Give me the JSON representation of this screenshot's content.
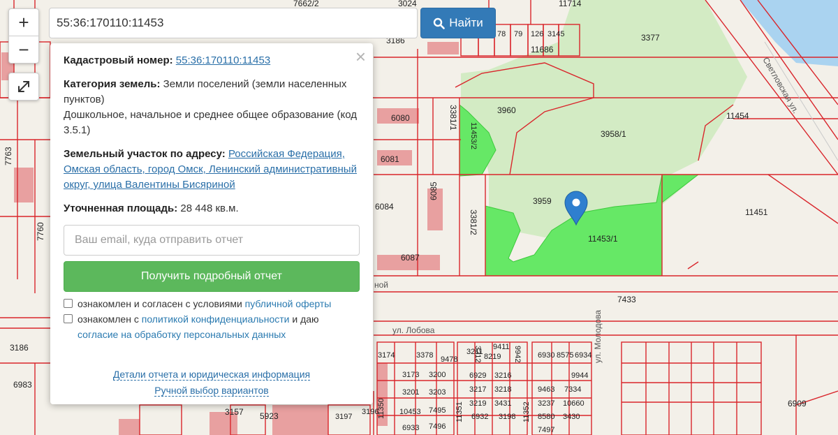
{
  "search": {
    "value": "55:36:170110:11453",
    "button_label": "Найти",
    "icon": "search-icon"
  },
  "zoom": {
    "in_label": "+",
    "out_label": "−",
    "fullscreen_icon": "expand-arrows-icon"
  },
  "popup": {
    "close_label": "×",
    "cadastral_label": "Кадастровый номер:",
    "cadastral_value": "55:36:170110:11453",
    "category_label": "Категория земель:",
    "category_value": "Земли поселений (земли населенных пунктов)",
    "usage_value": "Дошкольное, начальное и среднее общее образование (код 3.5.1)",
    "address_label": "Земельный участок по адресу:",
    "address_value": "Российская Федерация, Омская область, город Омск, Ленинский административный округ, улица Валентины Бисяриной",
    "area_label": "Уточненная площадь:",
    "area_value": "28 448 кв.м.",
    "email_placeholder": "Ваш email, куда отправить отчет",
    "report_button": "Получить подробный отчет",
    "agree1_text": "ознакомлен и согласен с условиями ",
    "agree1_link": "публичной оферты",
    "agree2_text1": "ознакомлен с ",
    "agree2_link1": "политикой конфиденциальности",
    "agree2_text2": " и даю ",
    "agree2_link2": "согласие на обработку персональных данных",
    "footer_link1": "Детали отчета и юридическая информация",
    "footer_link2": "Ручной выбор вариантов"
  },
  "map": {
    "colors": {
      "parcel_line": "#d9252b",
      "highlight": "#66e866",
      "park": "#d3ebc4",
      "building": "#e8a0a0",
      "water": "#aad3f0",
      "marker": "#2f7fcf"
    },
    "labels": [
      {
        "text": "3024"
      },
      {
        "text": "7662/2"
      },
      {
        "text": "3186"
      },
      {
        "text": "11714"
      },
      {
        "text": "78"
      },
      {
        "text": "79"
      },
      {
        "text": "126"
      },
      {
        "text": "3145"
      },
      {
        "text": "11686"
      },
      {
        "text": "3377"
      },
      {
        "text": "3960"
      },
      {
        "text": "3958/1"
      },
      {
        "text": "11454"
      },
      {
        "text": "6080"
      },
      {
        "text": "3381/1"
      },
      {
        "text": "11453/2"
      },
      {
        "text": "6081"
      },
      {
        "text": "6084"
      },
      {
        "text": "6085"
      },
      {
        "text": "3381/2"
      },
      {
        "text": "3959"
      },
      {
        "text": "11453/1"
      },
      {
        "text": "11451"
      },
      {
        "text": "6087"
      },
      {
        "text": "7433"
      },
      {
        "text": "ул. Лобова"
      },
      {
        "text": "Светловская ул."
      },
      {
        "text": "ул. Молодова"
      },
      {
        "text": "3174"
      },
      {
        "text": "3378"
      },
      {
        "text": "9478"
      },
      {
        "text": "3211"
      },
      {
        "text": "8219"
      },
      {
        "text": "9411"
      },
      {
        "text": "6930"
      },
      {
        "text": "8575"
      },
      {
        "text": "6934"
      },
      {
        "text": "3173"
      },
      {
        "text": "3200"
      },
      {
        "text": "6929"
      },
      {
        "text": "3216"
      },
      {
        "text": "9944"
      },
      {
        "text": "3201"
      },
      {
        "text": "3203"
      },
      {
        "text": "3217"
      },
      {
        "text": "3218"
      },
      {
        "text": "9463"
      },
      {
        "text": "7334"
      },
      {
        "text": "3219"
      },
      {
        "text": "3431"
      },
      {
        "text": "3237"
      },
      {
        "text": "10660"
      },
      {
        "text": "10453"
      },
      {
        "text": "7495"
      },
      {
        "text": "6932"
      },
      {
        "text": "8580"
      },
      {
        "text": "3198"
      },
      {
        "text": "3430"
      },
      {
        "text": "3197"
      },
      {
        "text": "3196"
      },
      {
        "text": "6933"
      },
      {
        "text": "7496"
      },
      {
        "text": "7497"
      },
      {
        "text": "3157"
      },
      {
        "text": "5923"
      },
      {
        "text": "3186"
      },
      {
        "text": "6983"
      },
      {
        "text": "7763"
      },
      {
        "text": "7760"
      },
      {
        "text": "6909"
      },
      {
        "text": "9942"
      },
      {
        "text": "3212"
      },
      {
        "text": "11350"
      },
      {
        "text": "11351"
      },
      {
        "text": "11352"
      },
      {
        "text": "ной"
      }
    ]
  }
}
